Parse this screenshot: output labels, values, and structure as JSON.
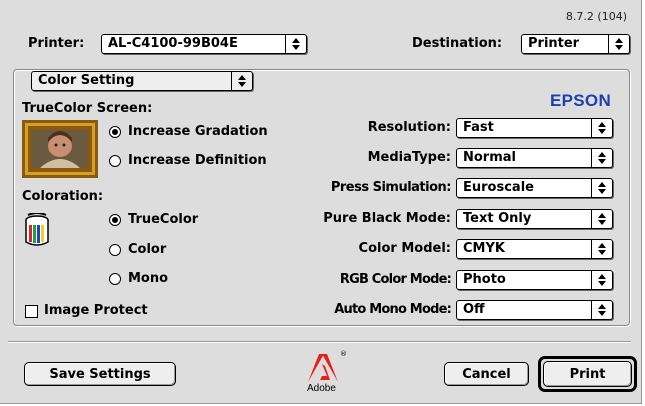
{
  "version": "8.7.2 (104)",
  "printer": {
    "label": "Printer:",
    "value": "AL-C4100-99B04E"
  },
  "destination": {
    "label": "Destination:",
    "value": "Printer"
  },
  "panel": {
    "value": "Color Setting"
  },
  "brand": "EPSON",
  "truecolor_screen": {
    "label": "TrueColor Screen:",
    "options": [
      {
        "label": "Increase Gradation",
        "selected": true
      },
      {
        "label": "Increase Definition",
        "selected": false
      }
    ]
  },
  "coloration": {
    "label": "Coloration:",
    "options": [
      {
        "label": "TrueColor",
        "selected": true
      },
      {
        "label": "Color",
        "selected": false
      },
      {
        "label": "Mono",
        "selected": false
      }
    ]
  },
  "image_protect": {
    "label": "Image Protect",
    "checked": false
  },
  "settings": [
    {
      "label": "Resolution:",
      "value": "Fast"
    },
    {
      "label": "MediaType:",
      "value": "Normal"
    },
    {
      "label": "Press Simulation:",
      "value": "Euroscale"
    },
    {
      "label": "Pure Black Mode:",
      "value": "Text Only"
    },
    {
      "label": "Color Model:",
      "value": "CMYK"
    },
    {
      "label": "RGB Color Mode:",
      "value": "Photo"
    },
    {
      "label": "Auto Mono Mode:",
      "value": "Off"
    }
  ],
  "footer": {
    "save_label": "Save Settings",
    "adobe_text": "Adobe",
    "cancel_label": "Cancel",
    "print_label": "Print"
  },
  "colors": {
    "epson_blue": "#1d3fb0",
    "adobe_red": "#e2231a",
    "dialog_bg": "#dddddd"
  },
  "icons": [
    "popup-arrows-icon",
    "photo-frame-icon",
    "paint-can-icon",
    "adobe-logo-icon",
    "registered-icon"
  ]
}
